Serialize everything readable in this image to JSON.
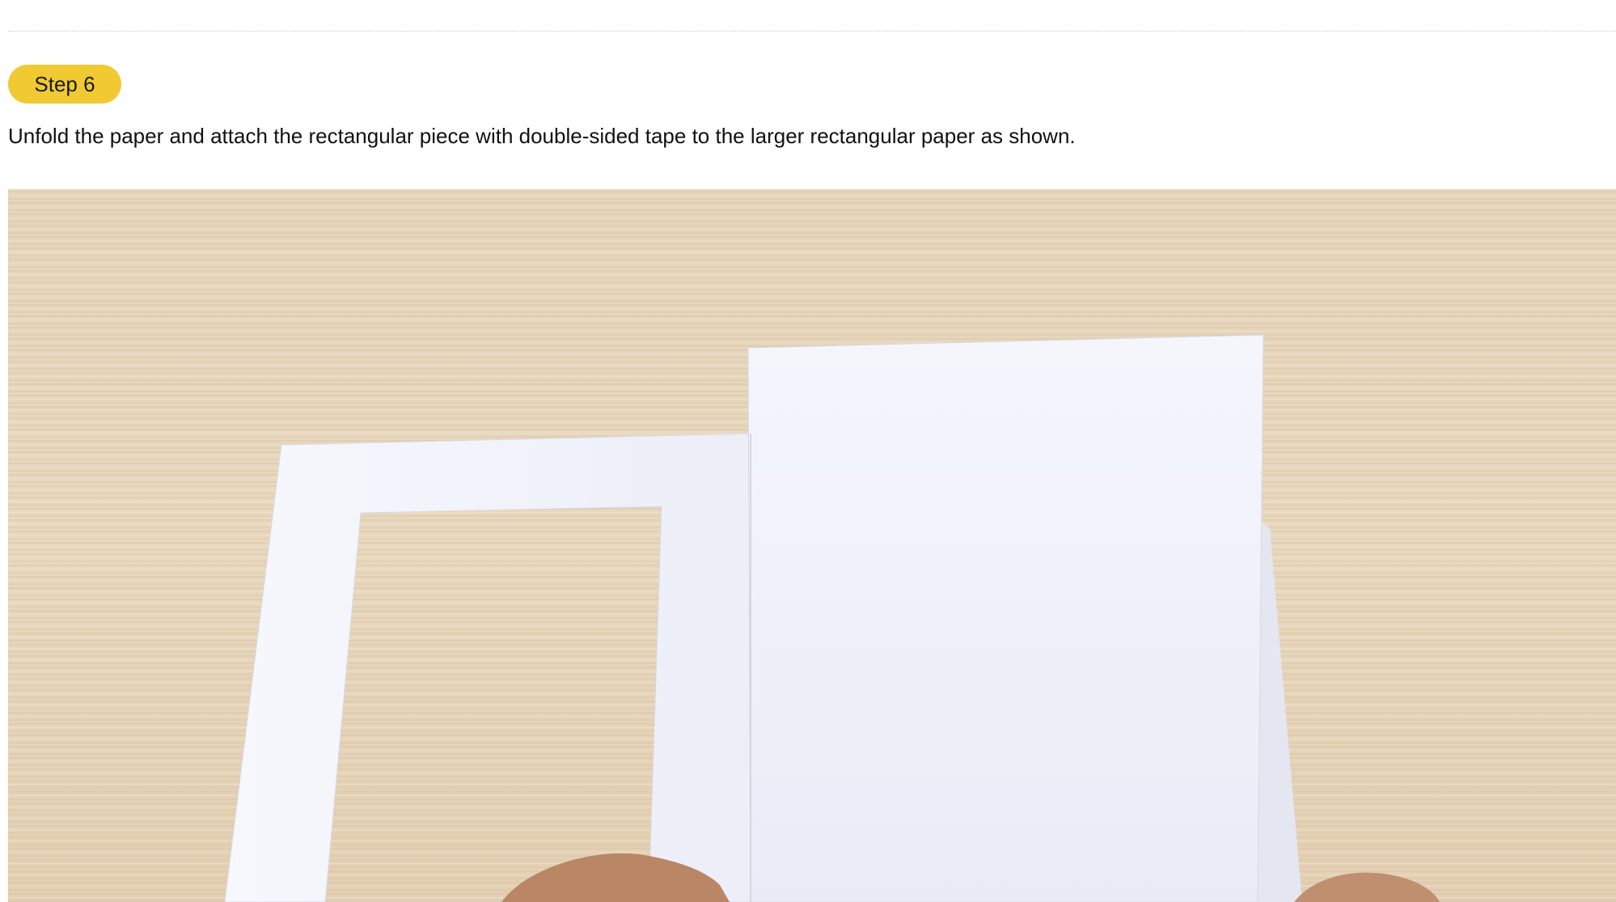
{
  "step": {
    "badge_label": "Step 6",
    "badge_color": "#f0c933",
    "instruction": "Unfold the paper and attach the rectangular piece with double-sided tape to the larger rectangular paper as shown."
  },
  "photo": {
    "subject": "paper-frame-craft-on-wooden-table",
    "background_color": "#e8d6bb",
    "paper_color": "#f3f4fb"
  }
}
